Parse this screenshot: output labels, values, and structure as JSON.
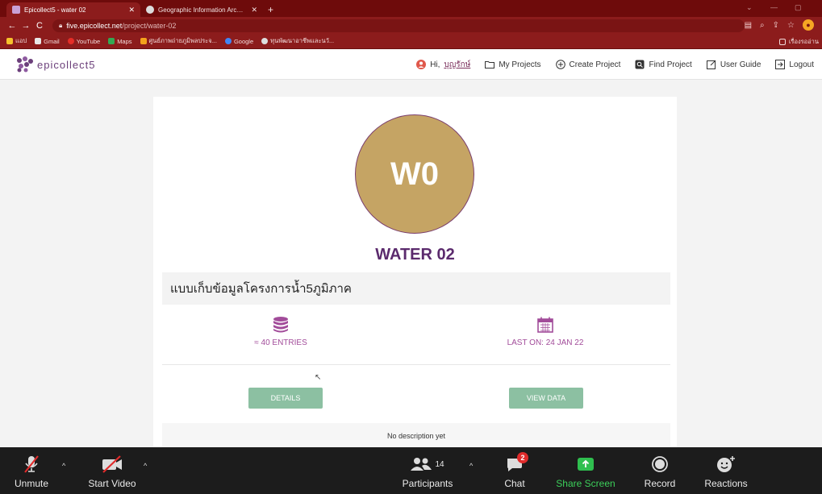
{
  "browser": {
    "tabs": [
      {
        "label": "Epicollect5 - water 02",
        "active": true
      },
      {
        "label": "Geographic Information Archive",
        "active": false
      }
    ],
    "new_tab": "+",
    "url_host": "five.epicollect.net",
    "url_path": "/project/water-02",
    "bookmarks": [
      {
        "label": "แอป",
        "icon": "apps-icon",
        "color": "#f6c12c"
      },
      {
        "label": "Gmail",
        "icon": "gmail-icon",
        "color": "#e8e8e8"
      },
      {
        "label": "YouTube",
        "icon": "youtube-icon",
        "color": "#e52d27"
      },
      {
        "label": "Maps",
        "icon": "maps-icon",
        "color": "#34a853"
      },
      {
        "label": "ศูนย์ภาพถ่ายภูมิพลประจ...",
        "icon": "bookmark-icon",
        "color": "#f4a21c"
      },
      {
        "label": "Google",
        "icon": "google-icon",
        "color": "#4285f4"
      },
      {
        "label": "ทุนพัฒนาอาชีพและนวั...",
        "icon": "globe-icon",
        "color": "#dddddd"
      }
    ],
    "reading_list": "เรื่องรออ่าน"
  },
  "app": {
    "logo_text": "epicollect5",
    "nav": {
      "greeting": "Hi,",
      "username": "บุญรักษ์",
      "my_projects": "My Projects",
      "create_project": "Create Project",
      "find_project": "Find Project",
      "user_guide": "User Guide",
      "logout": "Logout"
    },
    "project": {
      "avatar_text": "W0",
      "avatar_color": "#c5a464",
      "name": "WATER 02",
      "subtitle": "แบบเก็บข้อมูลโครงการน้ำ5ภูมิภาค",
      "entries": "≈ 40 ENTRIES",
      "last_on": "LAST ON: 24 JAN 22",
      "details_button": "DETAILS",
      "view_data_button": "VIEW DATA",
      "description": "No description yet"
    },
    "accent_color": "#a24c9a"
  },
  "zoom": {
    "unmute": "Unmute",
    "start_video": "Start Video",
    "participants": "Participants",
    "participants_count": "14",
    "chat": "Chat",
    "chat_badge": "2",
    "share_screen": "Share Screen",
    "record": "Record",
    "reactions": "Reactions"
  }
}
